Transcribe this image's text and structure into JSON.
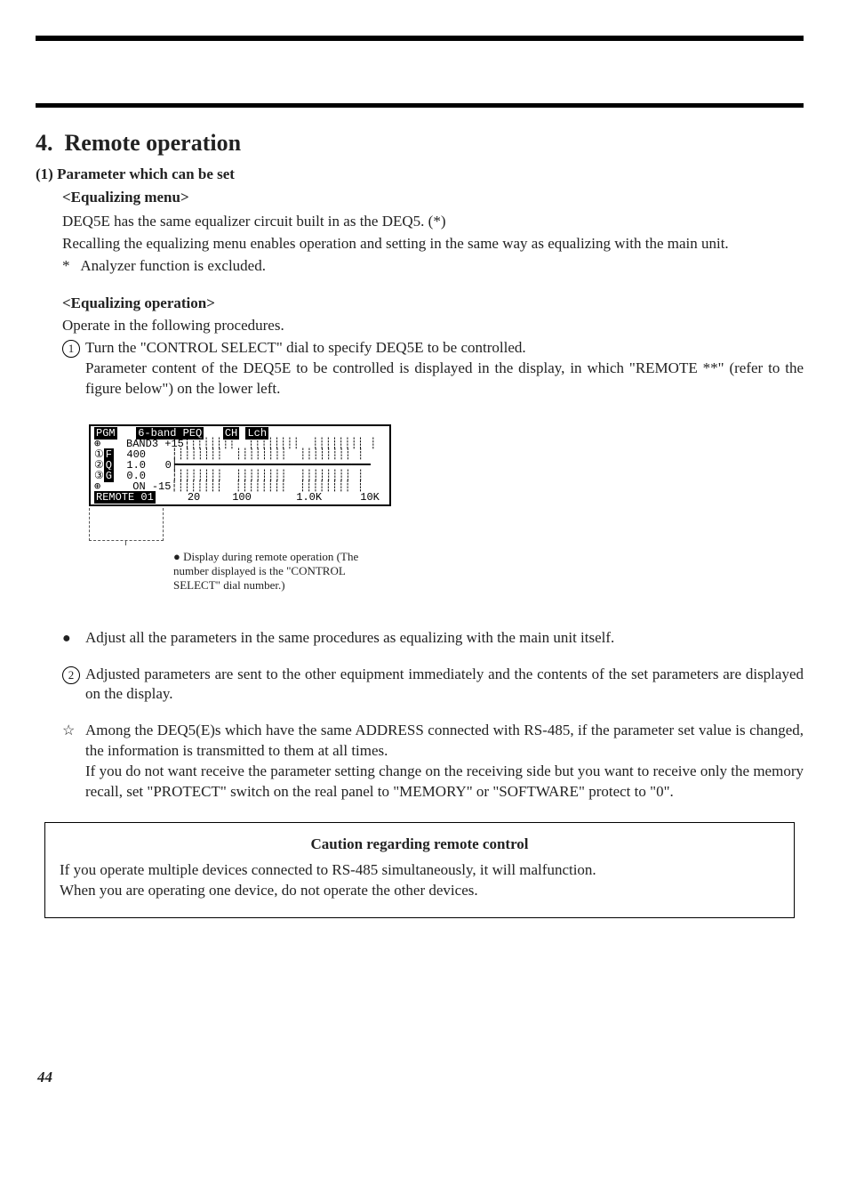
{
  "section_number": "4.",
  "section_title": "Remote operation",
  "sub1_label": "(1) Parameter which can be set",
  "eq_menu_label": "<Equalizing menu>",
  "eq_menu_line1": "DEQ5E has the same equalizer circuit built in as the DEQ5. (*)",
  "eq_menu_line2": "Recalling the equalizing menu enables operation and setting in the same way as equalizing with the main unit.",
  "eq_menu_note_marker": "*",
  "eq_menu_note": "Analyzer function is excluded.",
  "eq_op_label": "<Equalizing operation>",
  "eq_op_intro": "Operate in the following procedures.",
  "step1_marker": "1",
  "step1_line1": "Turn the \"CONTROL SELECT\" dial to specify DEQ5E to be controlled.",
  "step1_line2": "Parameter content of the DEQ5E to be controlled is displayed in the display, in which \"REMOTE **\" (refer to the figure below\") on the lower left.",
  "lcd": {
    "tag_pgm": "PGM",
    "title": "6-band PEQ",
    "tag_ch": "CH",
    "tag_lch": "Lch",
    "sidebar": [
      "F",
      "Q",
      "G"
    ],
    "param_band": "BAND3",
    "scale_top": "+15",
    "param_f": "  400",
    "param_q": "  1.0",
    "param_g": "  0.0",
    "param_state": "   ON",
    "scale_mid": "  0",
    "scale_bot": "-15",
    "remote": "REMOTE 01",
    "axis": "     20     100       1.0K      10K"
  },
  "lcd_caption_bullet": "●",
  "lcd_caption": "Display during remote operation (The number displayed is the \"CONTROL SELECT\" dial number.)",
  "bullet_adjust_marker": "●",
  "bullet_adjust": "Adjust all the parameters in the same procedures as equalizing with the main unit itself.",
  "step2_marker": "2",
  "step2": "Adjusted parameters are sent to the other equipment immediately and the contents of the set parameters are displayed on the display.",
  "star_marker": "☆",
  "star_para1": "Among the DEQ5(E)s which have the same ADDRESS connected with RS-485, if the parameter set value is changed, the information is transmitted to them at all times.",
  "star_para2": "If you do not want receive the parameter setting change on the receiving side but you want to receive only the memory recall, set \"PROTECT\" switch on the real panel to \"MEMORY\" or \"SOFTWARE\" protect to \"0\".",
  "caution_title": "Caution regarding remote control",
  "caution_line1": "If you operate multiple devices connected to RS-485 simultaneously, it will malfunction.",
  "caution_line2": "When you are operating one device, do not operate the other devices.",
  "page_number": "44"
}
